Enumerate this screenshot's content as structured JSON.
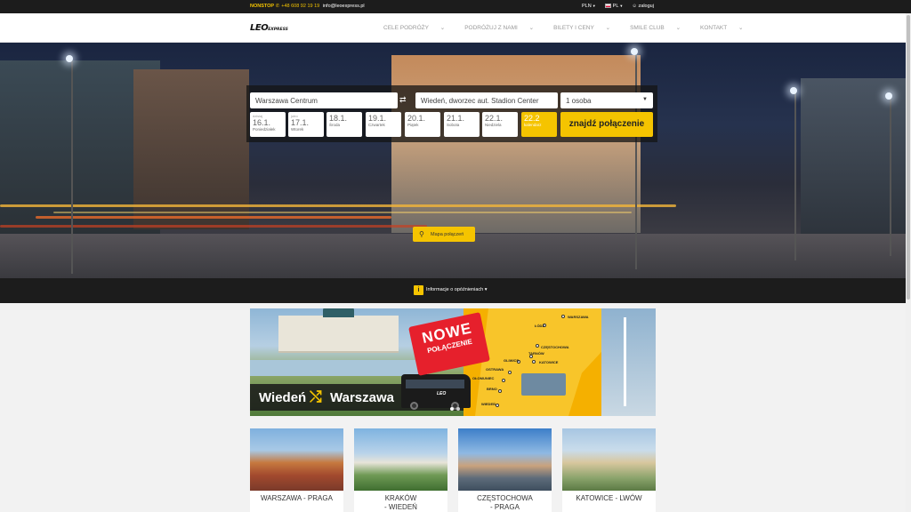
{
  "topbar": {
    "nonstop_label": "NONSTOP",
    "phone": "+48 608 92 19 19",
    "email": "info@leoexpress.pl",
    "currency": "PLN",
    "language": "PL",
    "login": "zaloguj"
  },
  "nav": {
    "logo_main": "LEO",
    "logo_sub": "EXPRESS",
    "menu": [
      {
        "label": "CELE PODRÓŻY"
      },
      {
        "label": "PODRÓŻUJ Z NAMI"
      },
      {
        "label": "BILETY I CENY"
      },
      {
        "label": "SMILE CLUB"
      },
      {
        "label": "KONTAKT"
      }
    ]
  },
  "search": {
    "from": "Warszawa Centrum",
    "to": "Wiedeń, dworzec aut. Stadion Center",
    "passengers": "1 osoba",
    "dates": [
      {
        "top": "dzisiaj",
        "num": "16.1.",
        "day": "Poniedziałek"
      },
      {
        "top": "jutro",
        "num": "17.1.",
        "day": "Wtorek"
      },
      {
        "top": "",
        "num": "18.1.",
        "day": "Środa"
      },
      {
        "top": "",
        "num": "19.1.",
        "day": "Czwartek"
      },
      {
        "top": "",
        "num": "20.1.",
        "day": "Piątek"
      },
      {
        "top": "",
        "num": "21.1.",
        "day": "Sobota"
      },
      {
        "top": "",
        "num": "22.1.",
        "day": "Niedziela"
      },
      {
        "top": "",
        "num": "22.2",
        "day": "kalendarz"
      }
    ],
    "find_label": "znajdź połączenie"
  },
  "map_button": "Mapa połączeń",
  "delay_info": "Informacje o opóźnieniach",
  "banner": {
    "badge_main": "NOWE",
    "badge_sub": "POŁĄCZENIE",
    "city_a": "Wiedeń",
    "city_b": "Warszawa",
    "bus_logo": "LEO",
    "stops": [
      "WARSZAWA",
      "ŁÓDŹ",
      "CZĘSTOCHOWA",
      "TARNÓW",
      "KATOWICE",
      "GLIWICE",
      "OSTRAWA",
      "OŁOMUNIEC",
      "BRNO",
      "WIEDEŃ"
    ]
  },
  "cards": [
    {
      "label": "WARSZAWA - PRAGA"
    },
    {
      "label_1": "KRAKÓW",
      "label_2": "- WIEDEŃ"
    },
    {
      "label_1": "CZĘSTOCHOWA",
      "label_2": "- PRAGA"
    },
    {
      "label": "KATOWICE - LWÓW"
    }
  ],
  "colors": {
    "accent": "#f5c400",
    "dark": "#1c1c1c",
    "badge_red": "#e6202c"
  }
}
